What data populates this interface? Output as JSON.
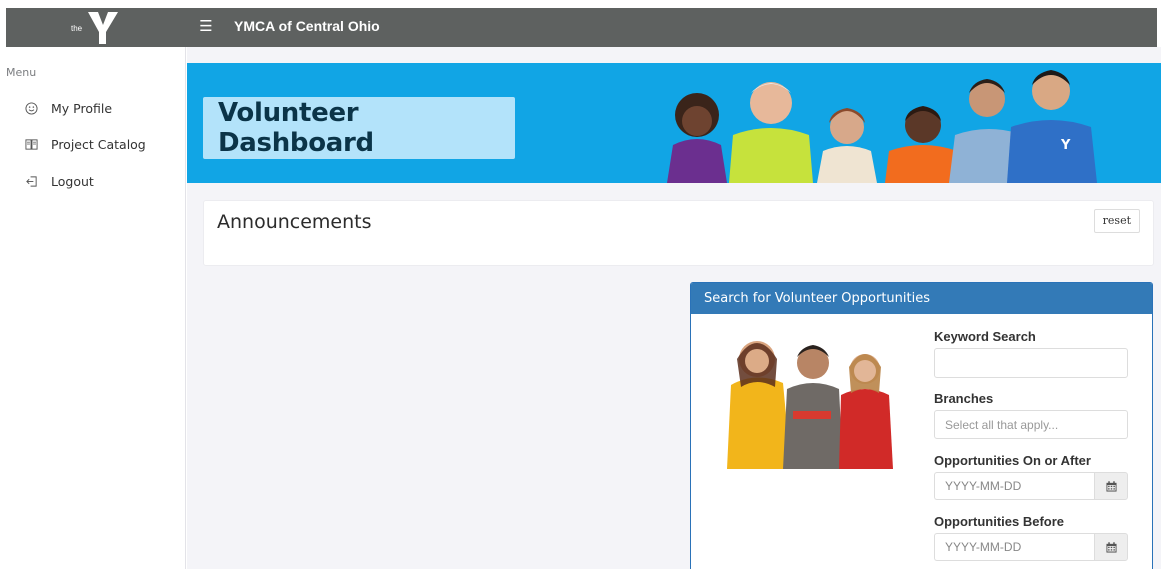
{
  "topbar": {
    "logo_small_text": "the",
    "menu_icon": "hamburger-icon",
    "title": "YMCA of Central Ohio"
  },
  "sidebar": {
    "menu_label": "Menu",
    "items": [
      {
        "label": "My Profile",
        "icon": "smiley-icon"
      },
      {
        "label": "Project Catalog",
        "icon": "book-icon"
      },
      {
        "label": "Logout",
        "icon": "logout-icon"
      }
    ]
  },
  "banner": {
    "title": "Volunteer Dashboard"
  },
  "announcements": {
    "title": "Announcements",
    "reset_label": "reset"
  },
  "search": {
    "heading": "Search for Volunteer Opportunities",
    "keyword_label": "Keyword Search",
    "keyword_value": "",
    "branches_label": "Branches",
    "branches_placeholder": "Select all that apply...",
    "on_or_after_label": "Opportunities On or After",
    "on_or_after_placeholder": "YYYY-MM-DD",
    "before_label": "Opportunities Before",
    "before_placeholder": "YYYY-MM-DD",
    "calendar_icon": "calendar-icon"
  },
  "colors": {
    "topbar": "#5e6160",
    "banner": "#11a5e5",
    "banner_title_box": "#b3e3fa",
    "panel_header": "#337ab7"
  }
}
